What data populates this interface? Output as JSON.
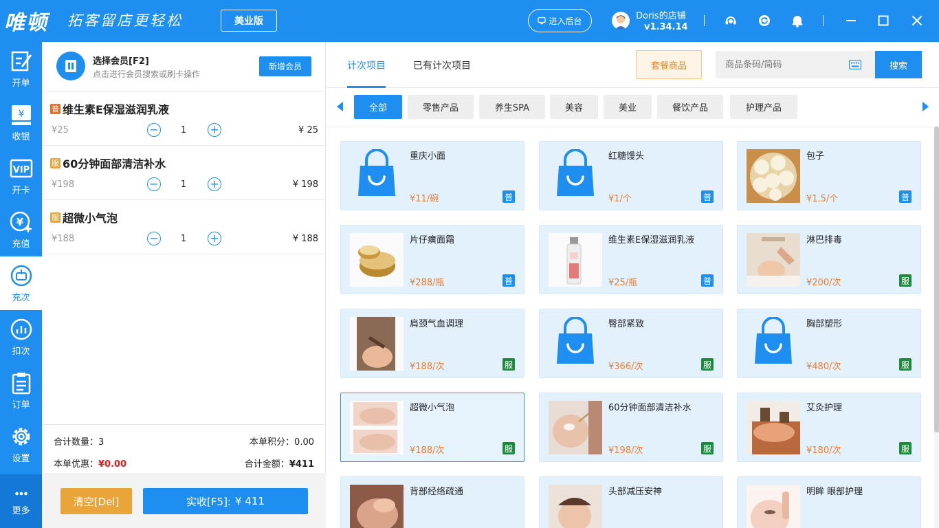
{
  "titlebar": {
    "logo": "唯顿",
    "slogan": "拓客留店更轻松",
    "edition": "美业版",
    "admin_button": "进入后台",
    "store_name": "Doris的店铺",
    "version": "v1.34.14"
  },
  "nav": {
    "items": [
      {
        "label": "开单"
      },
      {
        "label": "收银"
      },
      {
        "label": "开卡"
      },
      {
        "label": "充值"
      },
      {
        "label": "充次"
      },
      {
        "label": "扣次"
      },
      {
        "label": "订单"
      },
      {
        "label": "设置"
      },
      {
        "label": "更多"
      }
    ]
  },
  "member": {
    "title": "选择会员[F2]",
    "hint": "点击进行会员搜索或刷卡操作",
    "add_button": "新增会员"
  },
  "cart": {
    "items": [
      {
        "tag": "普",
        "name": "维生素E保湿滋润乳液",
        "unit_price": "¥25",
        "qty": "1",
        "total": "¥ 25"
      },
      {
        "tag": "服",
        "name": "60分钟面部清洁补水",
        "unit_price": "¥198",
        "qty": "1",
        "total": "¥ 198"
      },
      {
        "tag": "服",
        "name": "超微小气泡",
        "unit_price": "¥188",
        "qty": "1",
        "total": "¥ 188"
      }
    ],
    "minus": "−",
    "plus": "+"
  },
  "summary": {
    "qty_label": "合计数量：",
    "qty_value": "3",
    "points_label": "本单积分：",
    "points_value": "0.00",
    "discount_label": "本单优惠：",
    "discount_value": "¥0.00",
    "total_label": "合计金额：",
    "total_value": "¥411"
  },
  "footer": {
    "clear_button": "清空[Del]",
    "pay_label": "实收[F5]:",
    "pay_value": "¥ 411"
  },
  "tabs": [
    {
      "label": "计次项目"
    },
    {
      "label": "已有计次项目"
    }
  ],
  "combo_button": "套餐商品",
  "search": {
    "placeholder": "商品条码/简码",
    "button": "搜索"
  },
  "categories": [
    {
      "label": "全部"
    },
    {
      "label": "零售产品"
    },
    {
      "label": "养生SPA"
    },
    {
      "label": "美容"
    },
    {
      "label": "美业"
    },
    {
      "label": "餐饮产品"
    },
    {
      "label": "护理产品"
    }
  ],
  "products": [
    {
      "name": "重庆小面",
      "price": "¥11/碗",
      "tag": "普",
      "img": "bag-icon"
    },
    {
      "name": "红糖馒头",
      "price": "¥1/个",
      "tag": "普",
      "img": "bag-icon"
    },
    {
      "name": "包子",
      "price": "¥1.5/个",
      "tag": "普",
      "img": "buns-photo"
    },
    {
      "name": "片仔癀面霜",
      "price": "¥288/瓶",
      "tag": "普",
      "img": "cream-jar-photo"
    },
    {
      "name": "维生素E保湿滋润乳液",
      "price": "¥25/瓶",
      "tag": "普",
      "img": "lotion-bottle-photo"
    },
    {
      "name": "淋巴排毒",
      "price": "¥200/次",
      "tag": "服",
      "img": "massage-photo"
    },
    {
      "name": "肩颈气血调理",
      "price": "¥188/次",
      "tag": "服",
      "img": "neck-treatment-photo"
    },
    {
      "name": "臀部紧致",
      "price": "¥366/次",
      "tag": "服",
      "img": "bag-icon"
    },
    {
      "name": "胸部塑形",
      "price": "¥480/次",
      "tag": "服",
      "img": "bag-icon"
    },
    {
      "name": "超微小气泡",
      "price": "¥188/次",
      "tag": "服",
      "img": "bubble-facial-photo"
    },
    {
      "name": "60分钟面部清洁补水",
      "price": "¥198/次",
      "tag": "服",
      "img": "facial-cleansing-photo"
    },
    {
      "name": "艾灸护理",
      "price": "¥180/次",
      "tag": "服",
      "img": "moxibustion-photo"
    },
    {
      "name": "背部经络疏通",
      "price": "",
      "tag": "",
      "img": "back-massage-photo"
    },
    {
      "name": "头部减压安神",
      "price": "",
      "tag": "",
      "img": "head-massage-photo"
    },
    {
      "name": "明眸 眼部护理",
      "price": "",
      "tag": "",
      "img": "eye-care-photo"
    }
  ],
  "colors": {
    "primary": "#1e8ff0",
    "price": "#f07c2a",
    "service_tag": "#1e8a3e",
    "clear_button": "#e9a43a"
  }
}
